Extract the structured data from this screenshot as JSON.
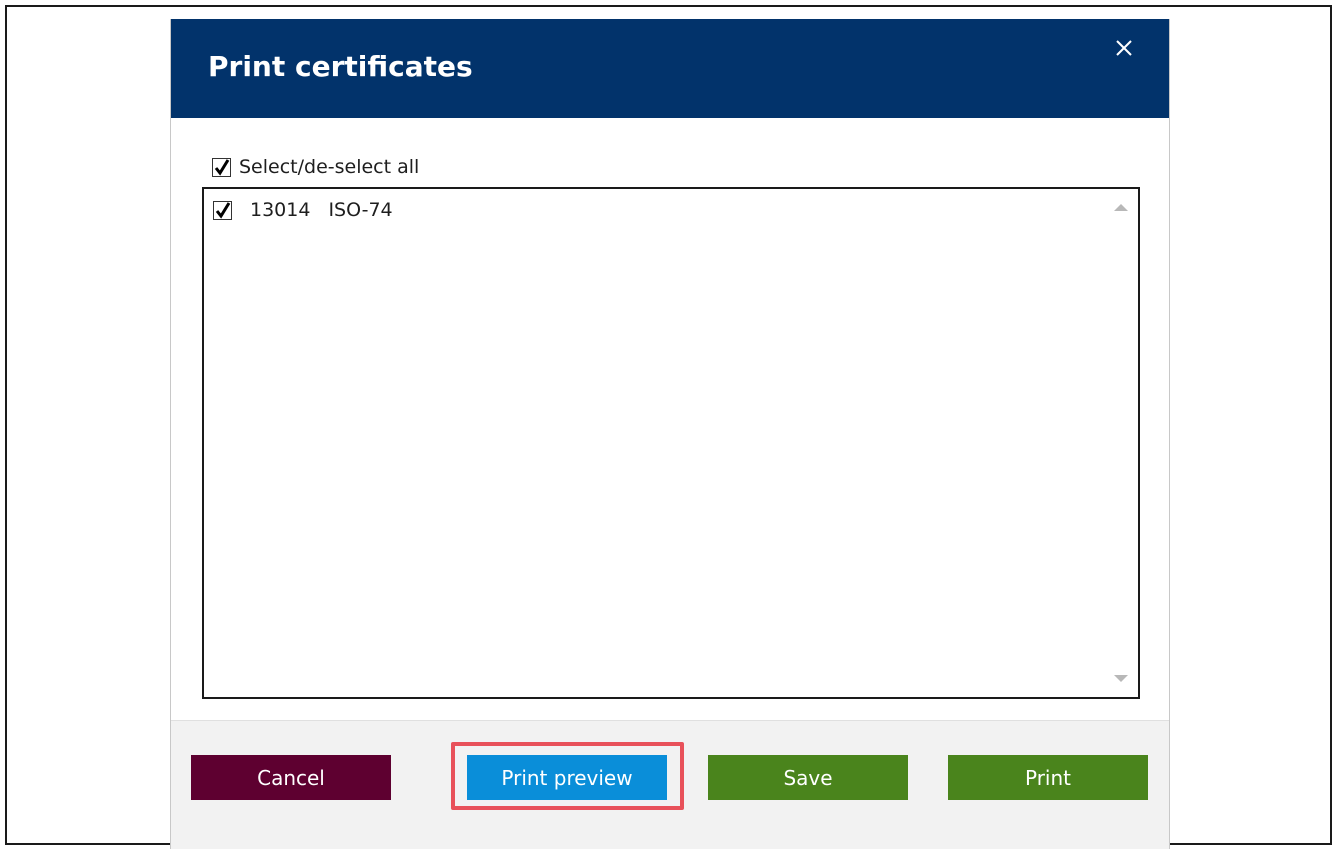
{
  "dialog": {
    "title": "Print certificates",
    "select_all": {
      "label": "Select/de-select all",
      "checked": true
    },
    "items": [
      {
        "code": "13014",
        "name": "ISO-74",
        "checked": true
      }
    ],
    "buttons": {
      "cancel": "Cancel",
      "preview": "Print preview",
      "save": "Save",
      "print": "Print"
    }
  },
  "colors": {
    "titlebar": "#02336b",
    "cancel": "#5e0030",
    "preview": "#0a8ed9",
    "save": "#4a841c",
    "print": "#4a841c",
    "highlight": "#e8515a"
  },
  "icons": [
    "close-icon",
    "checkmark-icon",
    "scroll-up-icon",
    "scroll-down-icon"
  ]
}
